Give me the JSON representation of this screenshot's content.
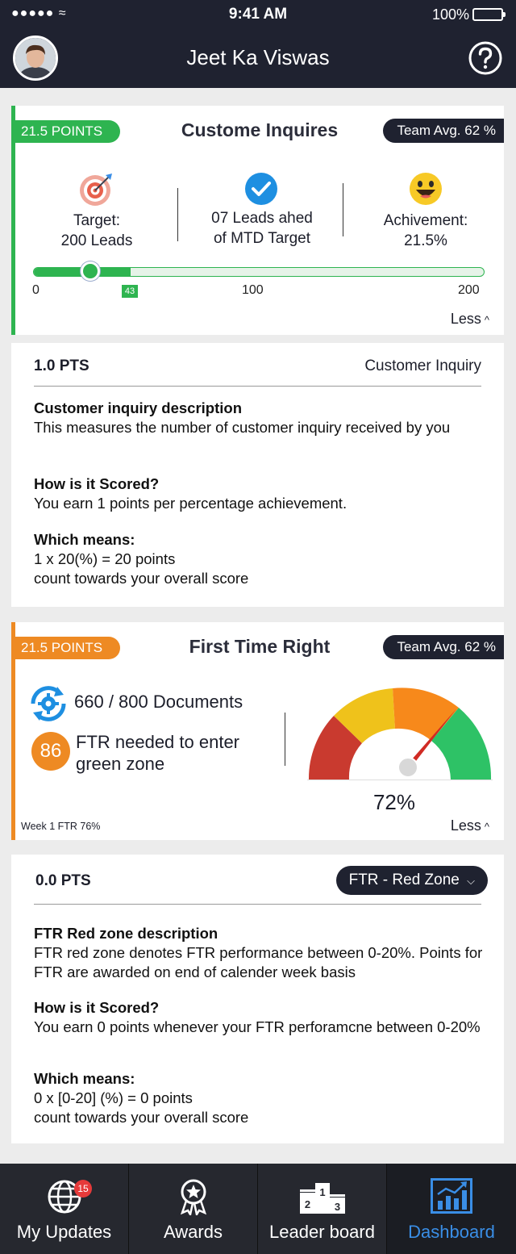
{
  "status_bar": {
    "signal": "●●●●● ≈",
    "time": "9:41 AM",
    "battery": "100%"
  },
  "header": {
    "user_name": "Jeet Ka Viswas"
  },
  "card1": {
    "points": "21.5 POINTS",
    "title": "Custome Inquires",
    "team_avg": "Team Avg. 62 %",
    "target_line1": "Target:",
    "target_line2": "200 Leads",
    "leads_line1": "07 Leads ahed",
    "leads_line2": "of MTD Target",
    "achievement_line1": "Achivement:",
    "achievement_line2": "21.5%",
    "slider": {
      "min": 0,
      "max": 200,
      "value": 43,
      "thumb_value": 25,
      "min_label": "0",
      "mid_label": "100",
      "max_label": "200",
      "marker_label": "43"
    },
    "less": "Less"
  },
  "detail1": {
    "pts": "1.0 PTS",
    "type": "Customer Inquiry",
    "desc_heading": "Customer inquiry description",
    "desc_text": "This measures the number of customer inquiry received by you",
    "scored_heading": "How is it Scored?",
    "scored_text": "You earn 1 points per percentage achievement.",
    "means_heading": "Which means:",
    "means_line1": "1 x 20(%) = 20 points",
    "means_line2": "count towards your overall score"
  },
  "card2": {
    "points": "21.5 POINTS",
    "title": "First Time Right",
    "team_avg": "Team Avg. 62 %",
    "documents": "660 / 800 Documents",
    "ftr_needed_value": "86",
    "ftr_needed_text": "FTR needed to enter green zone",
    "gauge_value_label": "72%",
    "gauge_value": 72,
    "week_label": "Week 1 FTR 76%",
    "less": "Less"
  },
  "detail2": {
    "pts": "0.0 PTS",
    "dropdown": "FTR - Red Zone",
    "desc_heading": "FTR Red zone description",
    "desc_text": "FTR red zone denotes FTR performance between 0-20%. Points for FTR are awarded on end of calender week basis",
    "scored_heading": "How is it Scored?",
    "scored_text": "You earn 0 points whenever your FTR perforamcne between 0-20%",
    "means_heading": "Which means:",
    "means_line1": "0 x [0-20] (%) = 0 points",
    "means_line2": "count towards your overall score"
  },
  "tabs": [
    {
      "label": "My Updates",
      "badge": "15",
      "icon": "globe-icon"
    },
    {
      "label": "Awards",
      "icon": "award-icon"
    },
    {
      "label": "Leader board",
      "icon": "podium-icon"
    },
    {
      "label": "Dashboard",
      "icon": "chart-icon",
      "active": true
    }
  ],
  "colors": {
    "green": "#2eb450",
    "orange": "#ee8a23",
    "dark": "#1f2230",
    "active_tab": "#3a8ee6"
  }
}
